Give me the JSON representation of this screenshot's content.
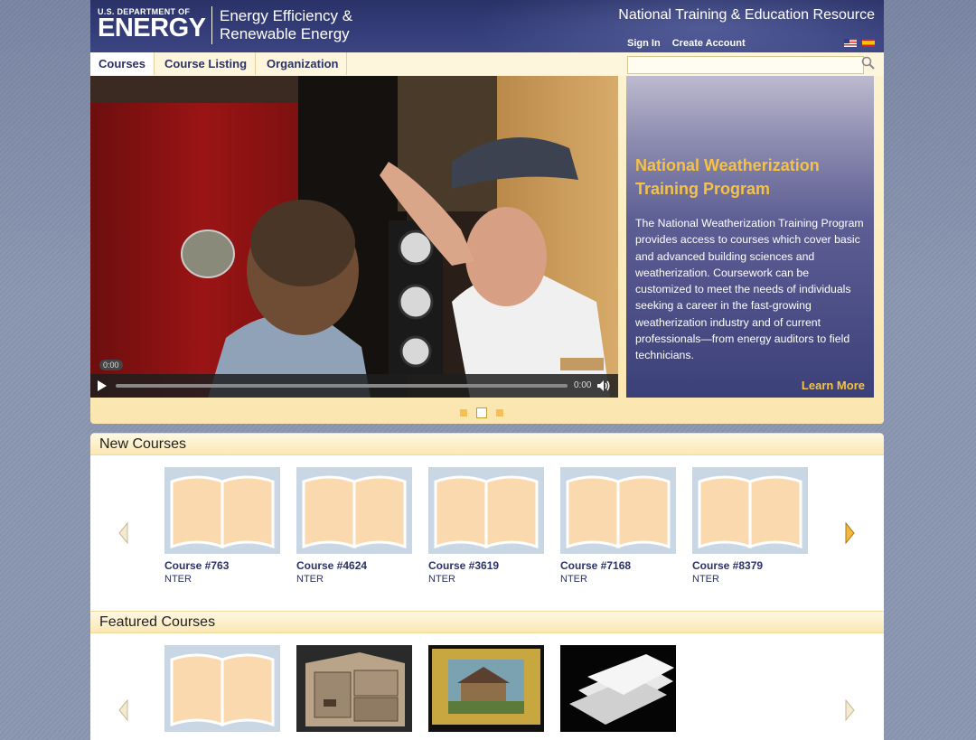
{
  "header": {
    "agency_small": "U.S. DEPARTMENT OF",
    "agency_big": "ENERGY",
    "program_line1": "Energy Efficiency &",
    "program_line2": "Renewable Energy",
    "site_title": "National Training & Education Resource",
    "sign_in": "Sign In",
    "create_account": "Create Account"
  },
  "nav": {
    "tabs": [
      {
        "label": "Courses"
      },
      {
        "label": "Course Listing"
      },
      {
        "label": "Organization"
      }
    ],
    "search_placeholder": ""
  },
  "hero": {
    "video_time_bubble": "0:00",
    "video_time": "0:00",
    "title": "National Weatherization Training Program",
    "description": "The National Weatherization Training Program provides access to courses which cover basic and advanced building sciences and weatherization. Coursework can be customized to meet the needs of individuals seeking a career in the fast-growing weatherization industry and of current professionals—from energy auditors to field technicians.",
    "learn_more": "Learn More",
    "slide_count": 3,
    "active_slide": 2
  },
  "new_courses": {
    "heading": "New Courses",
    "items": [
      {
        "title": "Course #763",
        "org": "NTER"
      },
      {
        "title": "Course #4624",
        "org": "NTER"
      },
      {
        "title": "Course #3619",
        "org": "NTER"
      },
      {
        "title": "Course #7168",
        "org": "NTER"
      },
      {
        "title": "Course #8379",
        "org": "NTER"
      }
    ]
  },
  "featured_courses": {
    "heading": "Featured Courses"
  },
  "colors": {
    "header_navy": "#343d78",
    "accent_gold": "#f5c246",
    "nav_text": "#2b3266",
    "cream": "#fdf2cf"
  }
}
